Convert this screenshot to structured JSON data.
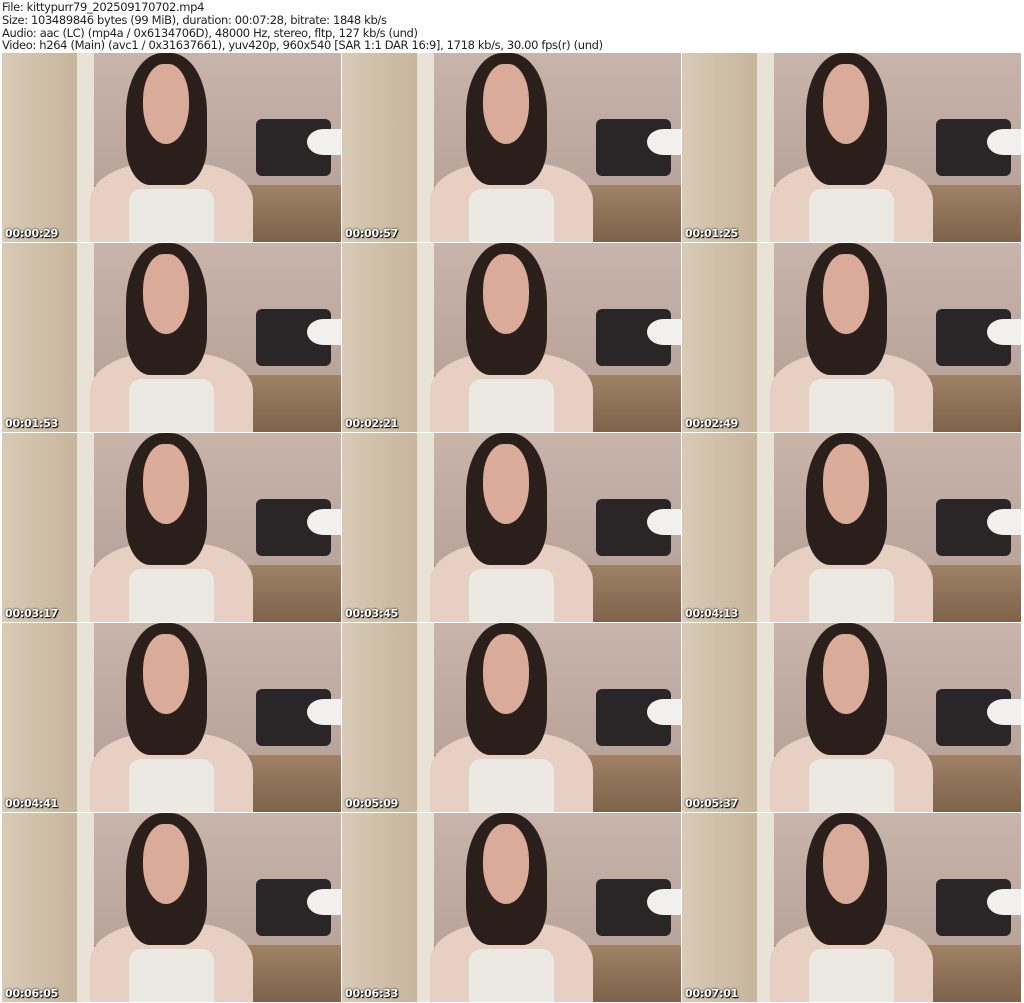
{
  "info": {
    "file": "File: kittypurr79_202509170702.mp4",
    "size": "Size: 103489846 bytes (99 MiB), duration: 00:07:28, bitrate: 1848 kb/s",
    "audio": "Audio: aac (LC) (mp4a / 0x6134706D), 48000 Hz, stereo, fltp, 127 kb/s (und)",
    "video": "Video: h264 (Main) (avc1 / 0x31637661), yuv420p, 960x540 [SAR 1:1 DAR 16:9], 1718 kb/s, 30.00 fps(r) (und)"
  },
  "thumbnails": [
    {
      "timestamp": "00:00:29"
    },
    {
      "timestamp": "00:00:57"
    },
    {
      "timestamp": "00:01:25"
    },
    {
      "timestamp": "00:01:53"
    },
    {
      "timestamp": "00:02:21"
    },
    {
      "timestamp": "00:02:49"
    },
    {
      "timestamp": "00:03:17"
    },
    {
      "timestamp": "00:03:45"
    },
    {
      "timestamp": "00:04:13"
    },
    {
      "timestamp": "00:04:41"
    },
    {
      "timestamp": "00:05:09"
    },
    {
      "timestamp": "00:05:37"
    },
    {
      "timestamp": "00:06:05"
    },
    {
      "timestamp": "00:06:33"
    },
    {
      "timestamp": "00:07:01"
    }
  ]
}
